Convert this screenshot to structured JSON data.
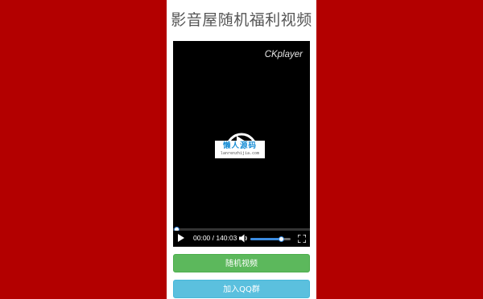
{
  "page_title": "影音屋随机福利视频",
  "player": {
    "brand": "CKplayer",
    "watermark": {
      "main": "懒人源码",
      "sub": "lanrenzhijia.com"
    },
    "time_display": "00:00 / 140:03",
    "progress": 0.0,
    "volume": 0.75,
    "icons": [
      "play-icon",
      "volume-icon",
      "fullscreen-icon",
      "big-play-icon"
    ]
  },
  "buttons": {
    "random_label": "随机视频",
    "join_qq_label": "加入QQ群"
  },
  "colors": {
    "background": "#b30000",
    "random_button": "#5cb85c",
    "qq_button": "#5bc0de",
    "accent": "#3b8be0"
  }
}
